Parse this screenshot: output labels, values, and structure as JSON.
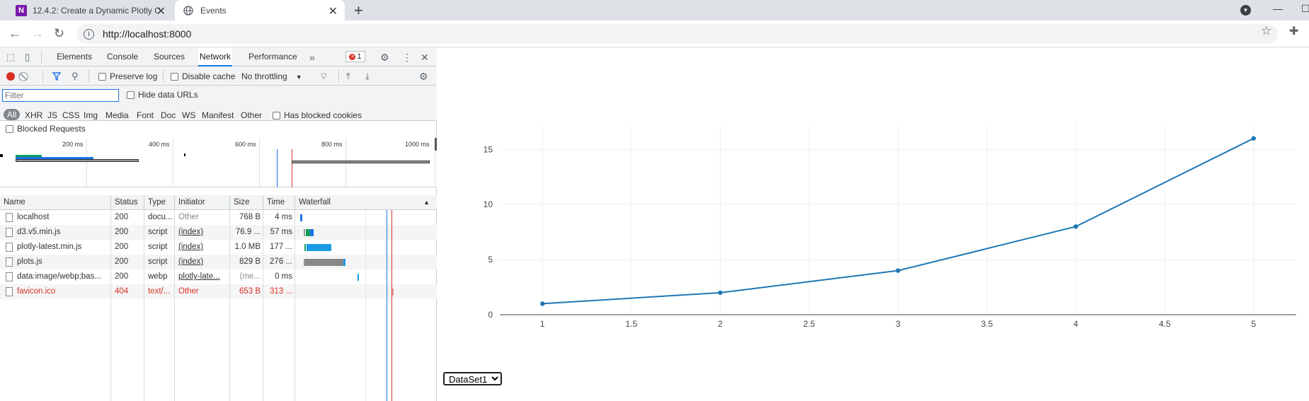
{
  "browser": {
    "tabs": [
      {
        "title": "12.4.2: Create a Dynamic Plotly C",
        "active": false
      },
      {
        "title": "Events",
        "active": true
      }
    ],
    "url": "http://localhost:8000"
  },
  "devtools": {
    "tabs": [
      "Elements",
      "Console",
      "Sources",
      "Network",
      "Performance"
    ],
    "active_tab": "Network",
    "error_count": "1",
    "toolbar": {
      "preserve_log": "Preserve log",
      "disable_cache": "Disable cache",
      "throttling": "No throttling"
    },
    "filter": {
      "placeholder": "Filter",
      "hide_data_urls": "Hide data URLs",
      "types": [
        "All",
        "XHR",
        "JS",
        "CSS",
        "Img",
        "Media",
        "Font",
        "Doc",
        "WS",
        "Manifest",
        "Other"
      ],
      "has_blocked_cookies": "Has blocked cookies",
      "blocked_requests": "Blocked Requests"
    },
    "overview_ticks": [
      "200 ms",
      "400 ms",
      "600 ms",
      "800 ms",
      "1000 ms"
    ],
    "table": {
      "headers": [
        "Name",
        "Status",
        "Type",
        "Initiator",
        "Size",
        "Time",
        "Waterfall"
      ],
      "rows": [
        {
          "name": "localhost",
          "status": "200",
          "type": "docu...",
          "initiator": "Other",
          "size": "768 B",
          "time": "4 ms"
        },
        {
          "name": "d3.v5.min.js",
          "status": "200",
          "type": "script",
          "initiator": "(index)",
          "size": "76.9 ...",
          "time": "57 ms"
        },
        {
          "name": "plotly-latest.min.js",
          "status": "200",
          "type": "script",
          "initiator": "(index)",
          "size": "1.0 MB",
          "time": "177 ..."
        },
        {
          "name": "plots.js",
          "status": "200",
          "type": "script",
          "initiator": "(index)",
          "size": "829 B",
          "time": "276 ..."
        },
        {
          "name": "data:image/webp;bas...",
          "status": "200",
          "type": "webp",
          "initiator": "plotly-late...",
          "size": "(me...",
          "time": "0 ms"
        },
        {
          "name": "favicon.ico",
          "status": "404",
          "type": "text/...",
          "initiator": "Other",
          "size": "653 B",
          "time": "313 ..."
        }
      ]
    }
  },
  "page": {
    "dropdown_value": "DataSet1",
    "chart_data": {
      "type": "line",
      "x": [
        1,
        2,
        3,
        4,
        5
      ],
      "y": [
        1,
        2,
        4,
        8,
        16
      ],
      "xlim": [
        0.76,
        5.24
      ],
      "ylim": [
        0,
        17.2
      ],
      "xticks": [
        "1",
        "1.5",
        "2",
        "2.5",
        "3",
        "3.5",
        "4",
        "4.5",
        "5"
      ],
      "yticks": [
        "0",
        "5",
        "10",
        "15"
      ],
      "grid": true,
      "line_color": "#1f77b4"
    }
  }
}
